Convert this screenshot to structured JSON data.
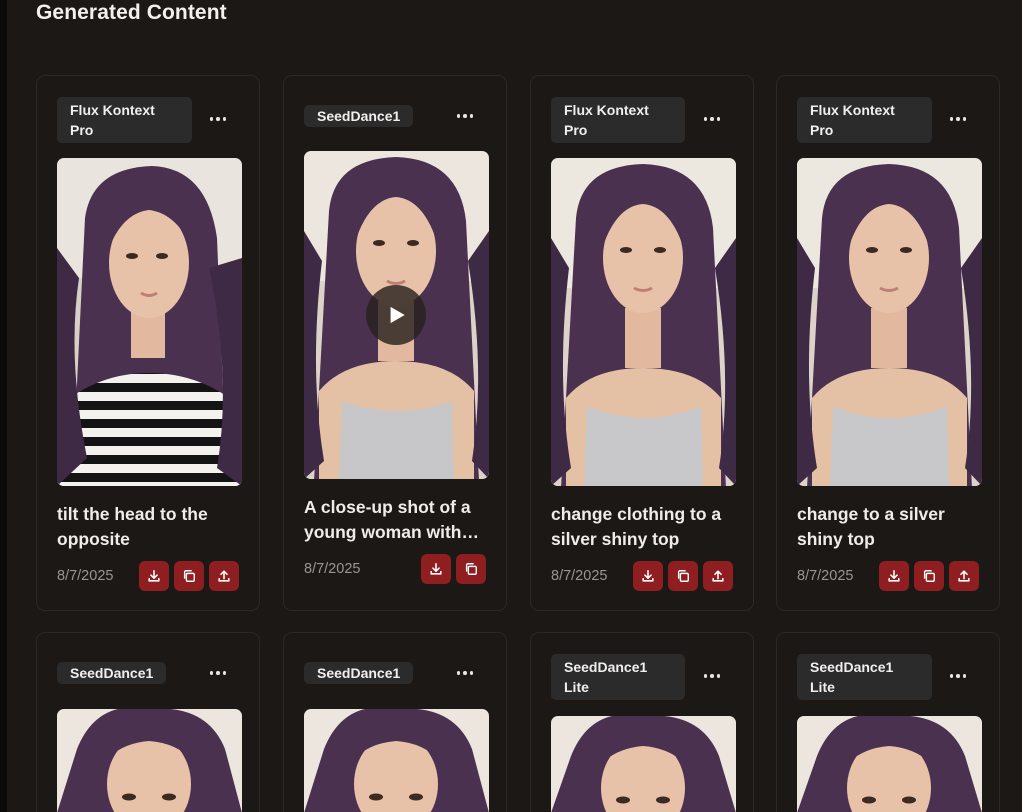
{
  "page": {
    "title": "Generated Content"
  },
  "cards": [
    {
      "model": "Flux Kontext Pro",
      "prompt": "tilt the head to the opposite",
      "date": "8/7/2025",
      "media": "image",
      "top": "striped-shirt-icon"
    },
    {
      "model": "SeedDance1",
      "prompt": "A close-up shot of a young woman with…",
      "date": "8/7/2025",
      "media": "video",
      "top": "silver-top-icon"
    },
    {
      "model": "Flux Kontext Pro",
      "prompt": "change clothing to a silver shiny top",
      "date": "8/7/2025",
      "media": "image",
      "top": "silver-top-icon"
    },
    {
      "model": "Flux Kontext Pro",
      "prompt": "change to a silver shiny top",
      "date": "8/7/2025",
      "media": "image",
      "top": "silver-top-icon"
    },
    {
      "model": "SeedDance1",
      "media": "video"
    },
    {
      "model": "SeedDance1",
      "media": "video"
    },
    {
      "model": "SeedDance1 Lite",
      "media": "video"
    },
    {
      "model": "SeedDance1 Lite",
      "media": "video"
    }
  ],
  "icons": {
    "more": "more-horizontal-icon",
    "download": "download-icon",
    "copy": "copy-icon",
    "share": "share-icon",
    "play": "play-icon"
  },
  "colors": {
    "background": "#1b1816",
    "card_border": "#2c2825",
    "badge": "#2c2b2c",
    "action": "#8e1e1f",
    "date": "#9c958f",
    "hair": "#4a3150",
    "skin": "#e7c2a8"
  }
}
